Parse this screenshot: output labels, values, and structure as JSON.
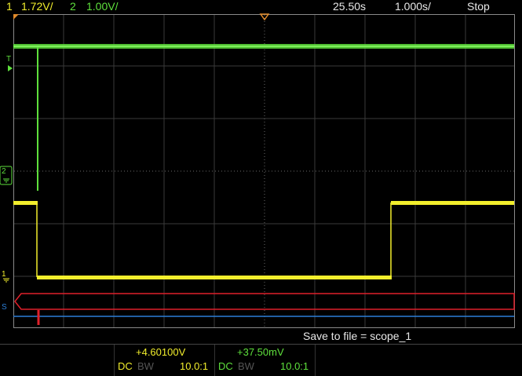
{
  "topbar": {
    "ch1_num": "1",
    "ch1_scale": "1.72V/",
    "ch2_num": "2",
    "ch2_scale": "1.00V/",
    "time_offset": "25.50s",
    "time_scale": "1.000s/",
    "run_state": "Stop"
  },
  "markers": {
    "trigger_label": "T",
    "ch2_ground": "2",
    "ch1_ground": "1",
    "serial_label": "S"
  },
  "status": {
    "save_message": "Save to file = scope_1"
  },
  "measurements": {
    "ch1_value": "+4.60100V",
    "ch2_value": "+37.50mV",
    "ch1_coupling": "DC",
    "ch1_bw": "BW",
    "ch1_probe": "10.0:1",
    "ch2_coupling": "DC",
    "ch2_bw": "BW",
    "ch2_probe": "10.0:1"
  },
  "colors": {
    "ch1": "#f2ee2c",
    "ch2": "#5ee03c",
    "serial": "#e0202a",
    "serial_blue": "#2c7fd8",
    "grid": "#3a3a3a"
  }
}
